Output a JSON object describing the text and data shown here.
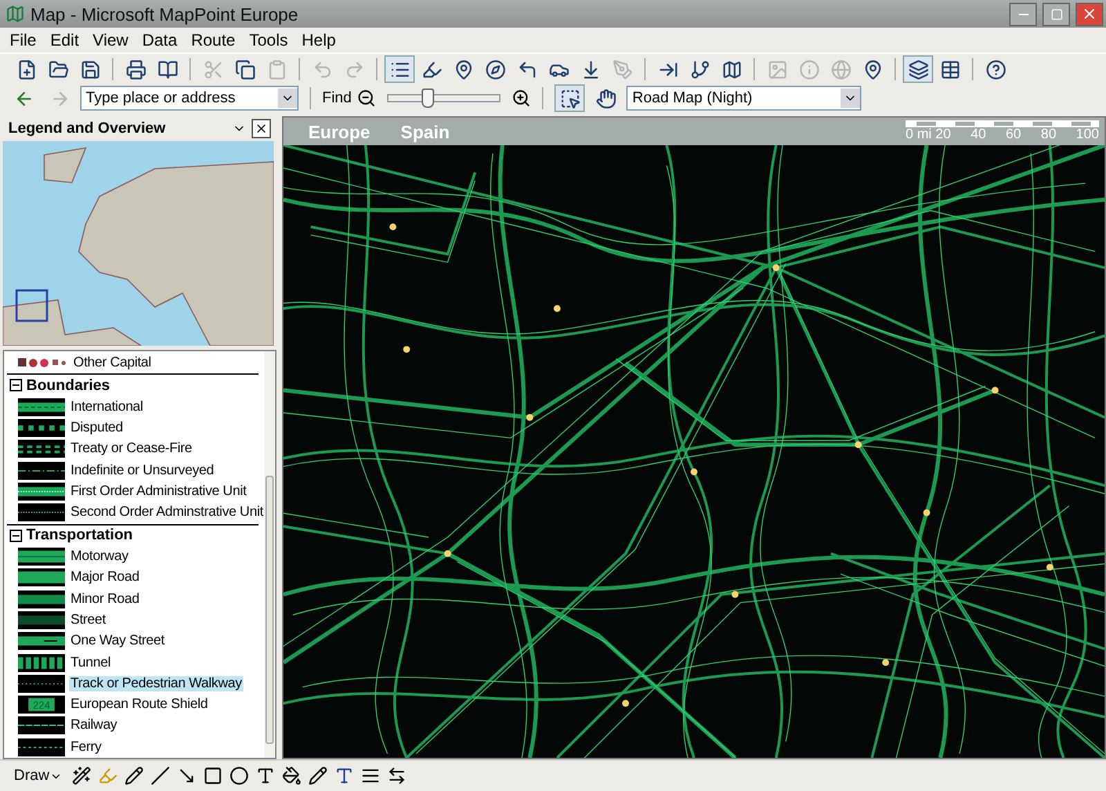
{
  "window": {
    "title": "Map - Microsoft MapPoint Europe"
  },
  "menu": [
    "File",
    "Edit",
    "View",
    "Data",
    "Route",
    "Tools",
    "Help"
  ],
  "toolbar": [
    {
      "kind": "new",
      "disabled": false,
      "pressed": false
    },
    {
      "kind": "open",
      "disabled": false,
      "pressed": false
    },
    {
      "kind": "save",
      "disabled": false,
      "pressed": false
    },
    {
      "kind": "sep"
    },
    {
      "kind": "print",
      "disabled": false,
      "pressed": false
    },
    {
      "kind": "book",
      "disabled": false,
      "pressed": false
    },
    {
      "kind": "sep"
    },
    {
      "kind": "cut",
      "disabled": true,
      "pressed": false
    },
    {
      "kind": "copy",
      "disabled": false,
      "pressed": false
    },
    {
      "kind": "paste",
      "disabled": true,
      "pressed": false
    },
    {
      "kind": "sep"
    },
    {
      "kind": "undo",
      "disabled": true,
      "pressed": false
    },
    {
      "kind": "redo",
      "disabled": true,
      "pressed": false
    },
    {
      "kind": "sep"
    },
    {
      "kind": "legend",
      "disabled": false,
      "pressed": true
    },
    {
      "kind": "highlight",
      "disabled": false,
      "pressed": false
    },
    {
      "kind": "pin",
      "disabled": false,
      "pressed": false
    },
    {
      "kind": "compass",
      "disabled": false,
      "pressed": false
    },
    {
      "kind": "turn",
      "disabled": false,
      "pressed": false
    },
    {
      "kind": "car",
      "disabled": false,
      "pressed": false
    },
    {
      "kind": "download",
      "disabled": false,
      "pressed": false
    },
    {
      "kind": "pen",
      "disabled": true,
      "pressed": false
    },
    {
      "kind": "sep"
    },
    {
      "kind": "insert",
      "disabled": false,
      "pressed": false
    },
    {
      "kind": "branch",
      "disabled": false,
      "pressed": false
    },
    {
      "kind": "map",
      "disabled": false,
      "pressed": false
    },
    {
      "kind": "sep"
    },
    {
      "kind": "image",
      "disabled": true,
      "pressed": false
    },
    {
      "kind": "info",
      "disabled": true,
      "pressed": false
    },
    {
      "kind": "globe",
      "disabled": true,
      "pressed": false
    },
    {
      "kind": "pin",
      "disabled": false,
      "pressed": false
    },
    {
      "kind": "sep"
    },
    {
      "kind": "layers",
      "disabled": false,
      "pressed": true
    },
    {
      "kind": "table",
      "disabled": false,
      "pressed": false
    },
    {
      "kind": "sep"
    },
    {
      "kind": "help",
      "disabled": false,
      "pressed": false
    }
  ],
  "navigation": {
    "forward_disabled": true,
    "address": {
      "placeholder": "Type place or address"
    },
    "find_label": "Find",
    "zoom": {
      "level": 0.35
    },
    "map_style": {
      "value": "Road Map (Night)"
    }
  },
  "legend_panel": {
    "title": "Legend and Overview",
    "partial_item": "Other Capital",
    "groups": [
      {
        "title": "Boundaries",
        "expanded": true,
        "items": [
          {
            "label": "International",
            "kind": "international",
            "selected": false
          },
          {
            "label": "Disputed",
            "kind": "disputed",
            "selected": false
          },
          {
            "label": "Treaty or Cease-Fire",
            "kind": "treaty",
            "selected": false
          },
          {
            "label": "Indefinite or Unsurveyed",
            "kind": "indefinite",
            "selected": false
          },
          {
            "label": "First Order Administrative Unit",
            "kind": "first_order",
            "selected": false
          },
          {
            "label": "Second Order Adminstrative Unit",
            "kind": "second_order",
            "selected": false
          }
        ]
      },
      {
        "title": "Transportation",
        "expanded": true,
        "items": [
          {
            "label": "Motorway",
            "kind": "motorway",
            "selected": false
          },
          {
            "label": "Major Road",
            "kind": "major",
            "selected": false
          },
          {
            "label": "Minor Road",
            "kind": "minor",
            "selected": false
          },
          {
            "label": "Street",
            "kind": "street",
            "selected": false
          },
          {
            "label": "One Way Street",
            "kind": "oneway",
            "selected": false
          },
          {
            "label": "Tunnel",
            "kind": "tunnel",
            "selected": false
          },
          {
            "label": "Track or Pedestrian Walkway",
            "kind": "track",
            "selected": true
          },
          {
            "label": "European Route Shield",
            "kind": "shield",
            "selected": false,
            "shield_text": "224"
          },
          {
            "label": "Railway",
            "kind": "railway",
            "selected": false
          },
          {
            "label": "Ferry",
            "kind": "ferry",
            "selected": false
          }
        ]
      }
    ]
  },
  "map": {
    "breadcrumb": [
      "Europe",
      "Spain"
    ],
    "scale_labels": [
      "0 mi 20",
      "40",
      "60",
      "80",
      "100"
    ]
  },
  "draw_toolbar": {
    "label": "Draw"
  }
}
